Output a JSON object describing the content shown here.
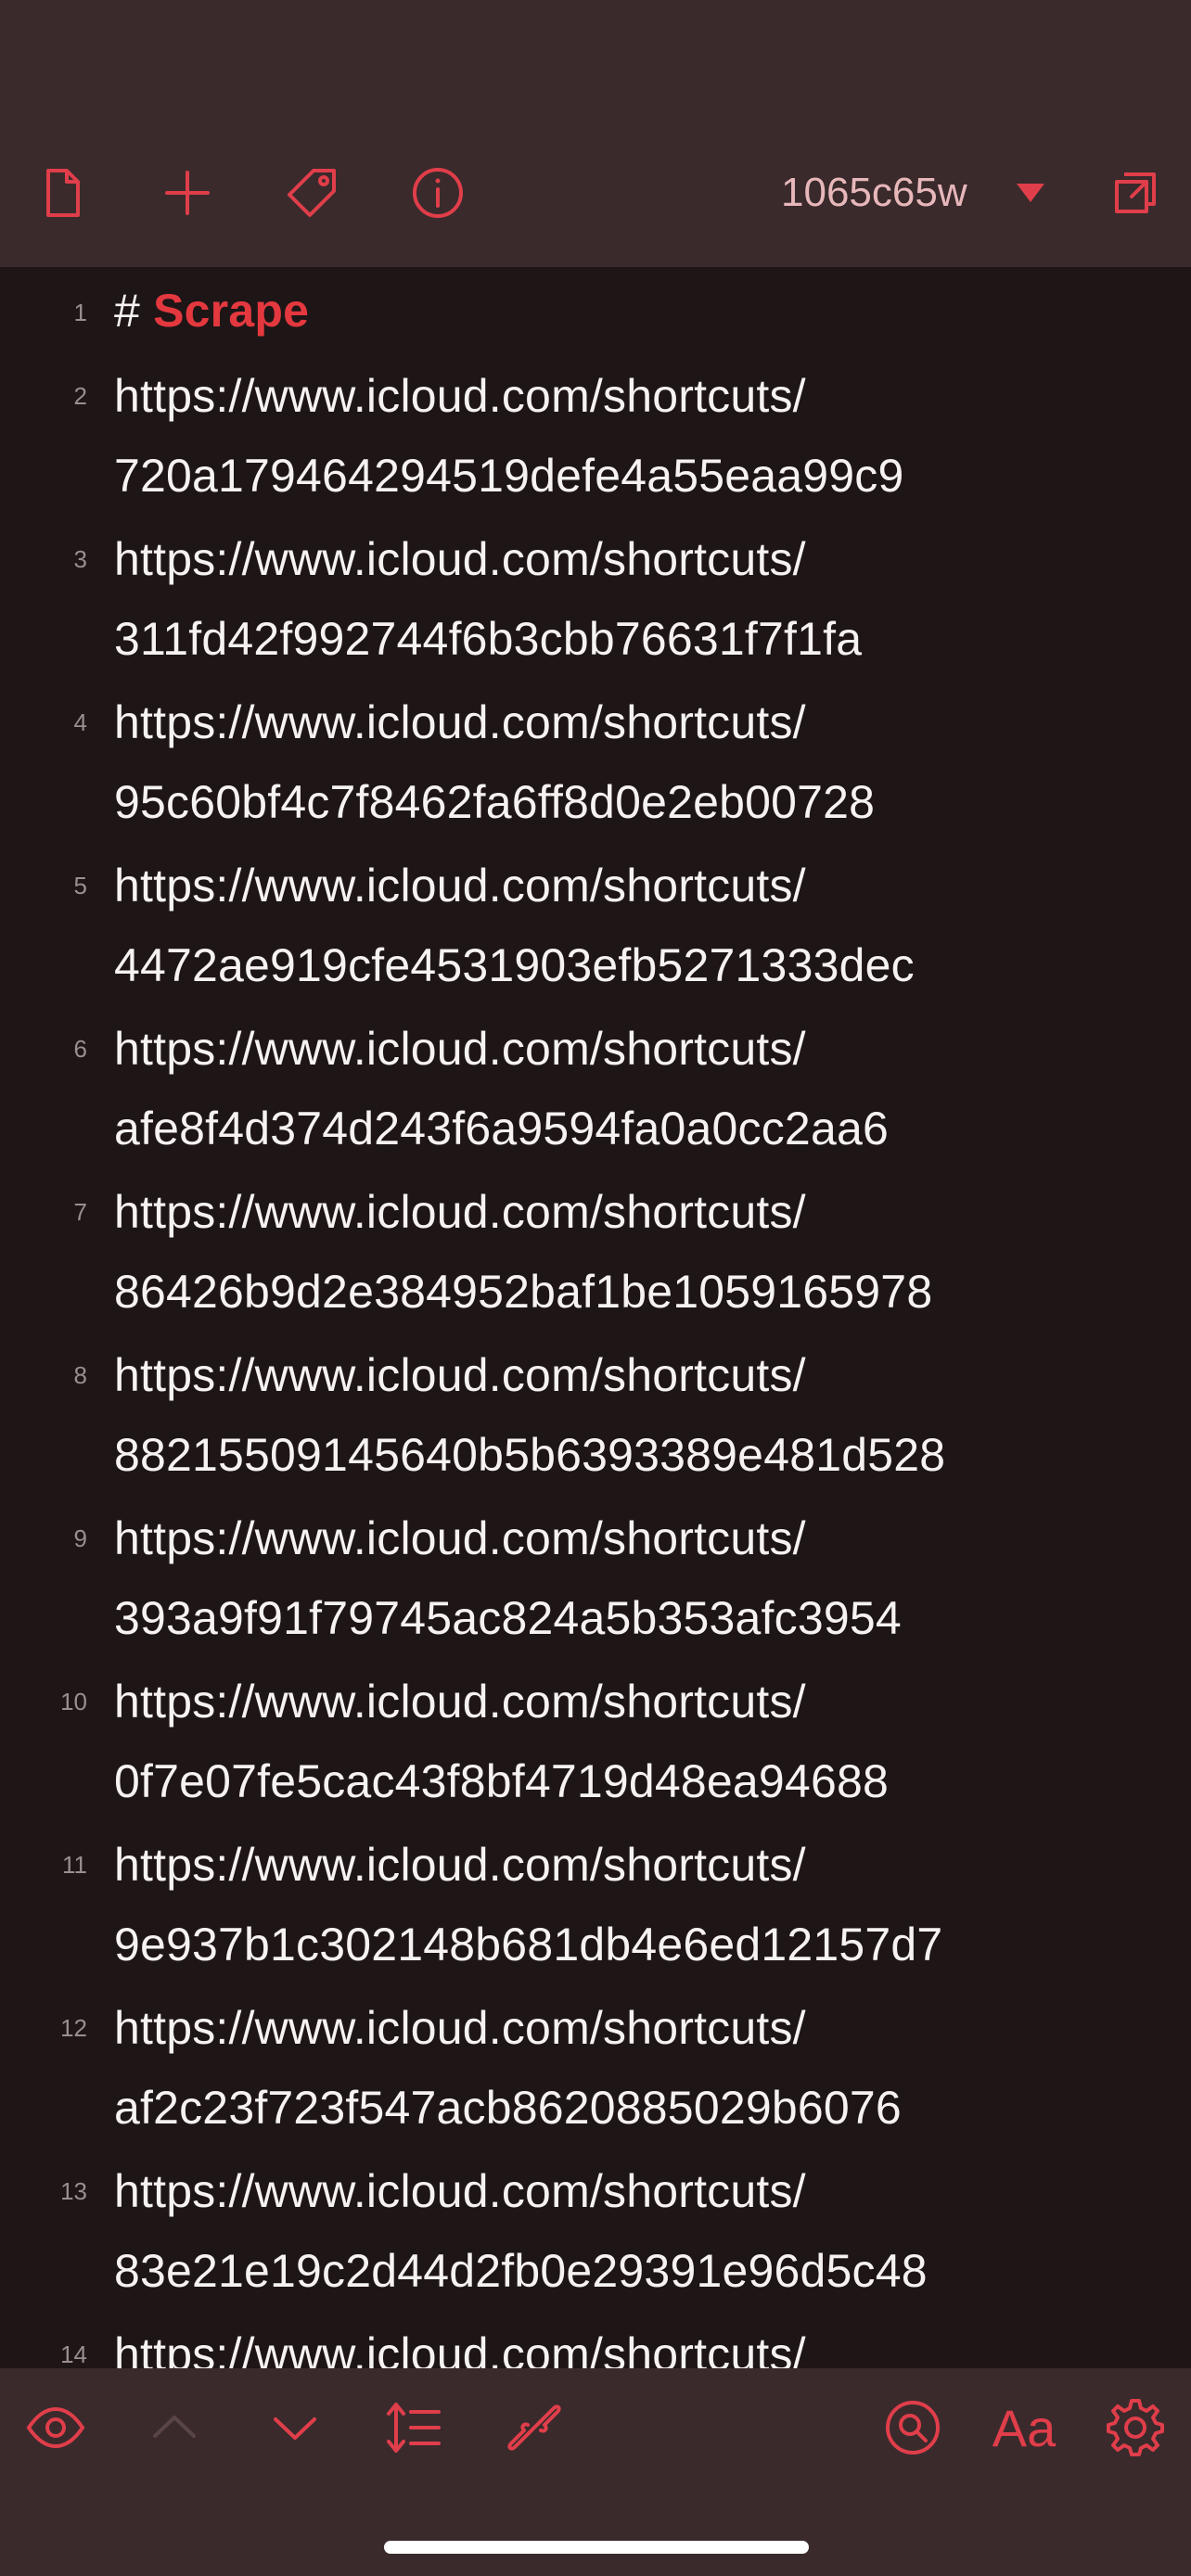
{
  "toolbar": {
    "document_name": "1065c65w",
    "icons": [
      "document-icon",
      "plus-icon",
      "tag-icon",
      "info-icon",
      "chevron-down-icon",
      "window-icon"
    ]
  },
  "editor": {
    "lines": [
      {
        "num": "1",
        "text": "Scrape",
        "type": "heading",
        "prefix": "#"
      },
      {
        "num": "2",
        "text": "https://www.icloud.com/shortcuts/\n720a179464294519defe4a55eaa99c9"
      },
      {
        "num": "3",
        "text": "https://www.icloud.com/shortcuts/\n311fd42f992744f6b3cbb76631f7f1fa"
      },
      {
        "num": "4",
        "text": "https://www.icloud.com/shortcuts/\n95c60bf4c7f8462fa6ff8d0e2eb00728"
      },
      {
        "num": "5",
        "text": "https://www.icloud.com/shortcuts/\n4472ae919cfe4531903efb5271333dec"
      },
      {
        "num": "6",
        "text": "https://www.icloud.com/shortcuts/\nafe8f4d374d243f6a9594fa0a0cc2aa6"
      },
      {
        "num": "7",
        "text": "https://www.icloud.com/shortcuts/\n86426b9d2e384952baf1be1059165978"
      },
      {
        "num": "8",
        "text": "https://www.icloud.com/shortcuts/\n88215509145640b5b6393389e481d528"
      },
      {
        "num": "9",
        "text": "https://www.icloud.com/shortcuts/\n393a9f91f79745ac824a5b353afc3954"
      },
      {
        "num": "10",
        "text": "https://www.icloud.com/shortcuts/\n0f7e07fe5cac43f8bf4719d48ea94688"
      },
      {
        "num": "11",
        "text": "https://www.icloud.com/shortcuts/\n9e937b1c302148b681db4e6ed12157d7"
      },
      {
        "num": "12",
        "text": "https://www.icloud.com/shortcuts/\naf2c23f723f547acb8620885029b6076"
      },
      {
        "num": "13",
        "text": "https://www.icloud.com/shortcuts/\n83e21e19c2d44d2fb0e29391e96d5c48"
      },
      {
        "num": "14",
        "text": "https://www.icloud.com/shortcuts/"
      }
    ]
  },
  "bottom_toolbar": {
    "font_label": "Aa",
    "icons": [
      "eye-icon",
      "chevron-up-icon",
      "chevron-down-icon",
      "line-spacing-icon",
      "link-icon",
      "search-icon",
      "gear-icon"
    ]
  },
  "colors": {
    "accent": "#e03e4a",
    "toolbar_bg": "#3a2a2c",
    "editor_bg": "#1e1516"
  }
}
